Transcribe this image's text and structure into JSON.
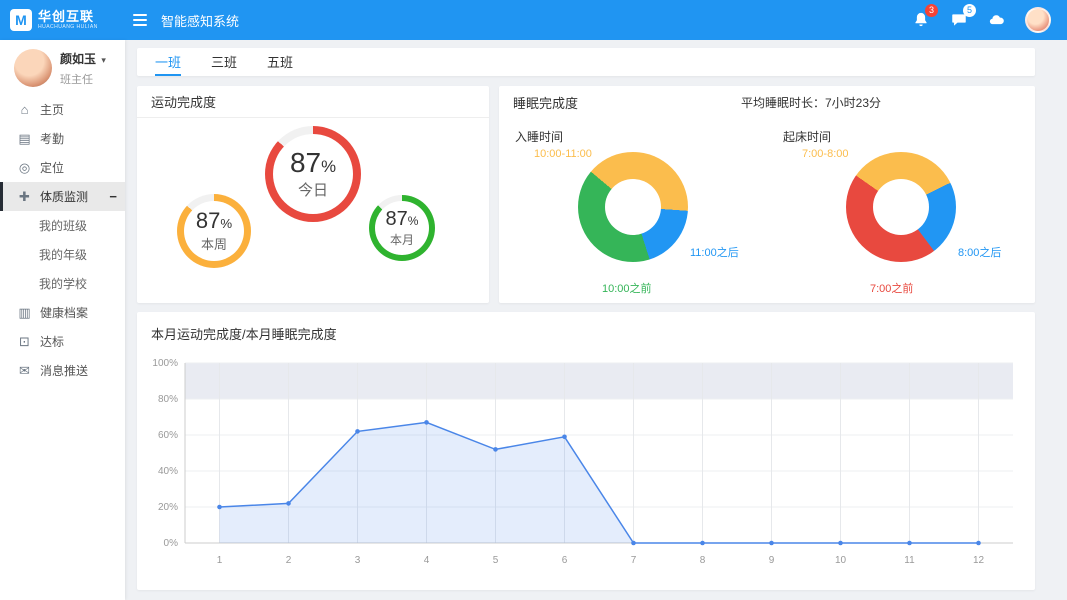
{
  "topbar": {
    "brand": "华创互联",
    "brand_sub": "HUACHUANG HULIAN",
    "logo_glyph": "M",
    "title": "智能感知系统",
    "bell_badge": "3",
    "message_badge": "5"
  },
  "icons": {
    "caret": "▾",
    "minus": "−",
    "home": "⌂",
    "attendance": "▤",
    "location": "◎",
    "physique": "✚",
    "archive": "▥",
    "standard": "⊡",
    "message": "✉"
  },
  "sidebar": {
    "user_name": "颜如玉",
    "user_role": "班主任",
    "items": [
      {
        "label": "主页",
        "icon": "home"
      },
      {
        "label": "考勤",
        "icon": "attendance"
      },
      {
        "label": "定位",
        "icon": "location"
      },
      {
        "label": "体质监测",
        "icon": "physique",
        "active": true,
        "expanded": true,
        "children": [
          {
            "label": "我的班级"
          },
          {
            "label": "我的年级"
          },
          {
            "label": "我的学校"
          }
        ]
      },
      {
        "label": "健康档案",
        "icon": "archive"
      },
      {
        "label": "达标",
        "icon": "standard"
      },
      {
        "label": "消息推送",
        "icon": "message"
      }
    ]
  },
  "tabs": {
    "items": [
      {
        "label": "一班",
        "active": true
      },
      {
        "label": "三班",
        "active": false
      },
      {
        "label": "五班",
        "active": false
      }
    ]
  },
  "sport": {
    "title": "运动完成度",
    "rings": [
      {
        "value": "87",
        "suffix": "%",
        "label": "今日",
        "percent": 87,
        "color": "#e8493f",
        "size": 96,
        "thickness": 8
      },
      {
        "value": "87",
        "suffix": "%",
        "label": "本周",
        "percent": 87,
        "color": "#fbb03c",
        "size": 74,
        "thickness": 7
      },
      {
        "value": "87",
        "suffix": "%",
        "label": "本月",
        "percent": 87,
        "color": "#2fb32f",
        "size": 66,
        "thickness": 6
      }
    ]
  },
  "sleep": {
    "title": "睡眠完成度",
    "avg_text": "平均睡眠时长：7小时23分",
    "donuts": [
      {
        "title": "入睡时间",
        "start_angle": -50,
        "segments": [
          {
            "label": "10:00-11:00",
            "value": 40,
            "color": "#fbbd4d"
          },
          {
            "label": "11:00之后",
            "value": 19,
            "color": "#2196f3"
          },
          {
            "label": "10:00之前",
            "value": 41,
            "color": "#35b558"
          }
        ]
      },
      {
        "title": "起床时间",
        "start_angle": -55,
        "segments": [
          {
            "label": "7:00-8:00",
            "value": 33,
            "color": "#fbbd4d"
          },
          {
            "label": "8:00之后",
            "value": 22,
            "color": "#2196f3"
          },
          {
            "label": "7:00之前",
            "value": 45,
            "color": "#e8493f"
          }
        ]
      }
    ]
  },
  "chart_data": {
    "type": "line",
    "title": "本月运动完成度/本月睡眠完成度",
    "x": [
      1,
      2,
      3,
      4,
      5,
      6,
      7,
      8,
      9,
      10,
      11,
      12
    ],
    "series": [
      {
        "name": "本月运动完成度",
        "color": "#4a86e8",
        "fill": "rgba(74,134,232,0.15)",
        "values": [
          20,
          22,
          62,
          67,
          52,
          59,
          0,
          0,
          0,
          0,
          0,
          0
        ]
      }
    ],
    "band": {
      "from": 80,
      "to": 100,
      "color": "#e9ebf2"
    },
    "ylim": [
      0,
      100
    ],
    "yticks": [
      0,
      20,
      40,
      60,
      80,
      100
    ],
    "ytick_suffix": "%",
    "grid": true,
    "legend_position": "none"
  }
}
